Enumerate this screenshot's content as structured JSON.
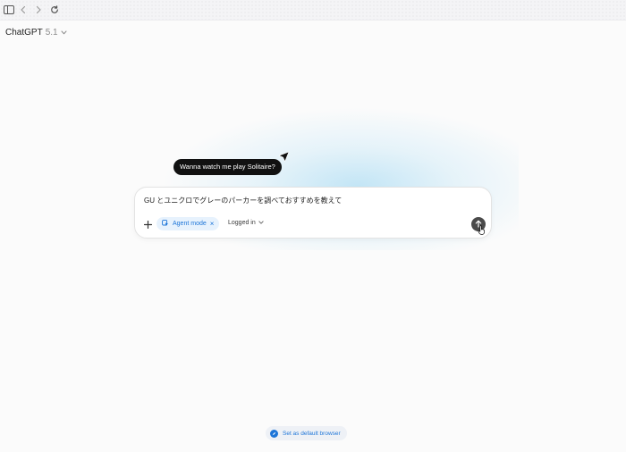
{
  "browser": {
    "icons": [
      "sidebar-toggle-icon",
      "back-arrow-icon",
      "forward-arrow-icon",
      "reload-icon"
    ]
  },
  "model_selector": {
    "name": "ChatGPT",
    "version": "5.1",
    "icon": "chevron-down-icon"
  },
  "tooltip": {
    "text": "Wanna watch me play Solitaire?"
  },
  "composer": {
    "prompt_text": "GU とユニクロでグレーのパーカーを調べておすすめを教えて",
    "add_icon": "plus-icon",
    "agent_chip": {
      "label": "Agent mode",
      "icon": "agent-mode-icon",
      "close_icon": "close-icon",
      "close_glyph": "×"
    },
    "login_dropdown": {
      "label": "Logged in",
      "icon": "chevron-down-icon"
    },
    "send_icon": "arrow-up-icon"
  },
  "footer": {
    "default_browser_label": "Set as default browser",
    "icon": "compass-icon"
  },
  "colors": {
    "accent": "#1d75d8",
    "chip_bg": "#e7f2fd",
    "send_button": "#4a4a4a",
    "tooltip_bg": "#111111",
    "glow": "#b0def4"
  }
}
